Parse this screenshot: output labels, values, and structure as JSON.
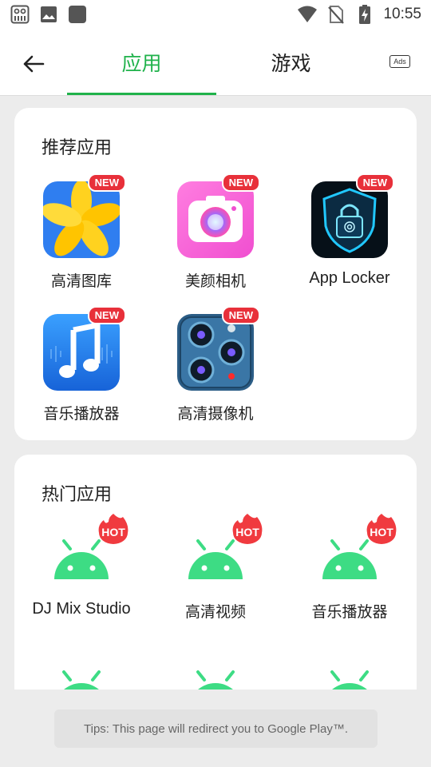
{
  "status_bar": {
    "time": "10:55",
    "icons": [
      "app-notification-icon",
      "image-icon",
      "square-icon",
      "wifi-icon",
      "no-sim-icon",
      "battery-charging-icon"
    ]
  },
  "topbar": {
    "tabs": [
      {
        "label": "应用",
        "selected": true
      },
      {
        "label": "游戏",
        "selected": false
      }
    ],
    "ads_label": "Ads",
    "accent_color": "#20b24b"
  },
  "recommended": {
    "title": "推荐应用",
    "badge": "NEW",
    "apps": [
      {
        "label": "高清图库",
        "icon": "gallery-flower-icon"
      },
      {
        "label": "美颜相机",
        "icon": "beauty-camera-icon"
      },
      {
        "label": "App Locker",
        "icon": "fingerprint-lock-icon"
      },
      {
        "label": "音乐播放器",
        "icon": "music-note-icon"
      },
      {
        "label": "高清摄像机",
        "icon": "multi-lens-camera-icon"
      }
    ]
  },
  "hot": {
    "title": "热门应用",
    "badge": "HOT",
    "apps": [
      {
        "label": "DJ Mix Studio",
        "icon": "android-icon"
      },
      {
        "label": "高清视频",
        "icon": "android-icon"
      },
      {
        "label": "音乐播放器",
        "icon": "android-icon"
      }
    ]
  },
  "tips": "Tips: This page will redirect you to Google Play™."
}
